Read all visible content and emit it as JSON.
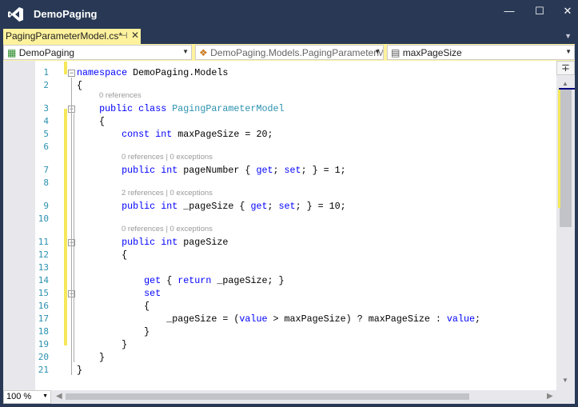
{
  "window": {
    "title": "DemoPaging",
    "logo": "visual-studio-logo",
    "controls": [
      "minimize-icon",
      "maximize-icon",
      "close-icon"
    ]
  },
  "tab": {
    "label": "PagingParameterModel.cs*",
    "pin": "⊣",
    "close": "✕",
    "highlight": "#fff29d"
  },
  "nav": {
    "project": "DemoPaging",
    "type": "DemoPaging.Models.PagingParameterMoc",
    "member": "maxPageSize"
  },
  "editor": {
    "lines": [
      {
        "n": "1",
        "t": [
          [
            "kw",
            "namespace"
          ],
          [
            "",
            "DemoPaging.Models"
          ]
        ]
      },
      {
        "n": "2",
        "t": [
          [
            "",
            "{"
          ]
        ]
      },
      {
        "n": "3",
        "lens": "0 references",
        "t": [
          [
            "",
            "    "
          ],
          [
            "kw",
            "public class"
          ],
          [
            "",
            ""
          ],
          [
            "ty",
            " PagingParameterModel"
          ]
        ]
      },
      {
        "n": "4",
        "t": [
          [
            "",
            "    {"
          ]
        ]
      },
      {
        "n": "5",
        "t": [
          [
            "",
            "        "
          ],
          [
            "kw",
            "const int"
          ],
          [
            "",
            " maxPageSize = 20;"
          ]
        ]
      },
      {
        "n": "6",
        "t": []
      },
      {
        "n": "7",
        "lens": "0 references | 0 exceptions",
        "t": [
          [
            "",
            "        "
          ],
          [
            "kw",
            "public int"
          ],
          [
            "",
            " pageNumber { "
          ],
          [
            "kw",
            "get"
          ],
          [
            "",
            "; "
          ],
          [
            "kw",
            "set"
          ],
          [
            "",
            "; } = 1;"
          ]
        ]
      },
      {
        "n": "8",
        "t": []
      },
      {
        "n": "9",
        "lens": "2 references | 0 exceptions",
        "t": [
          [
            "",
            "        "
          ],
          [
            "kw",
            "public int"
          ],
          [
            "",
            " _pageSize { "
          ],
          [
            "kw",
            "get"
          ],
          [
            "",
            "; "
          ],
          [
            "kw",
            "set"
          ],
          [
            "",
            "; } = 10;"
          ]
        ]
      },
      {
        "n": "10",
        "t": []
      },
      {
        "n": "11",
        "lens": "0 references | 0 exceptions",
        "t": [
          [
            "",
            "        "
          ],
          [
            "kw",
            "public int"
          ],
          [
            "",
            " pageSize"
          ]
        ]
      },
      {
        "n": "12",
        "t": [
          [
            "",
            "        {"
          ]
        ]
      },
      {
        "n": "13",
        "t": []
      },
      {
        "n": "14",
        "t": [
          [
            "",
            "            "
          ],
          [
            "kw",
            "get"
          ],
          [
            "",
            " { "
          ],
          [
            "kw",
            "return"
          ],
          [
            "",
            " _pageSize; }"
          ]
        ]
      },
      {
        "n": "15",
        "t": [
          [
            "",
            "            "
          ],
          [
            "kw",
            "set"
          ]
        ]
      },
      {
        "n": "16",
        "t": [
          [
            "",
            "            {"
          ]
        ]
      },
      {
        "n": "17",
        "t": [
          [
            "",
            "                _pageSize = ("
          ],
          [
            "kw",
            "value"
          ],
          [
            "",
            " > maxPageSize) ? maxPageSize : "
          ],
          [
            "kw",
            "value"
          ],
          [
            "",
            ";"
          ]
        ]
      },
      {
        "n": "18",
        "t": [
          [
            "",
            "            }"
          ]
        ]
      },
      {
        "n": "19",
        "t": [
          [
            "",
            "        }"
          ]
        ]
      },
      {
        "n": "20",
        "t": [
          [
            "",
            "    }"
          ]
        ]
      },
      {
        "n": "21",
        "t": [
          [
            "",
            "}"
          ]
        ]
      }
    ],
    "colors": {
      "keyword": "#0000ff",
      "type": "#2b91af",
      "line_number": "#2b91af",
      "changed": "#f5e85a"
    }
  },
  "status": {
    "zoom": "100 %"
  }
}
